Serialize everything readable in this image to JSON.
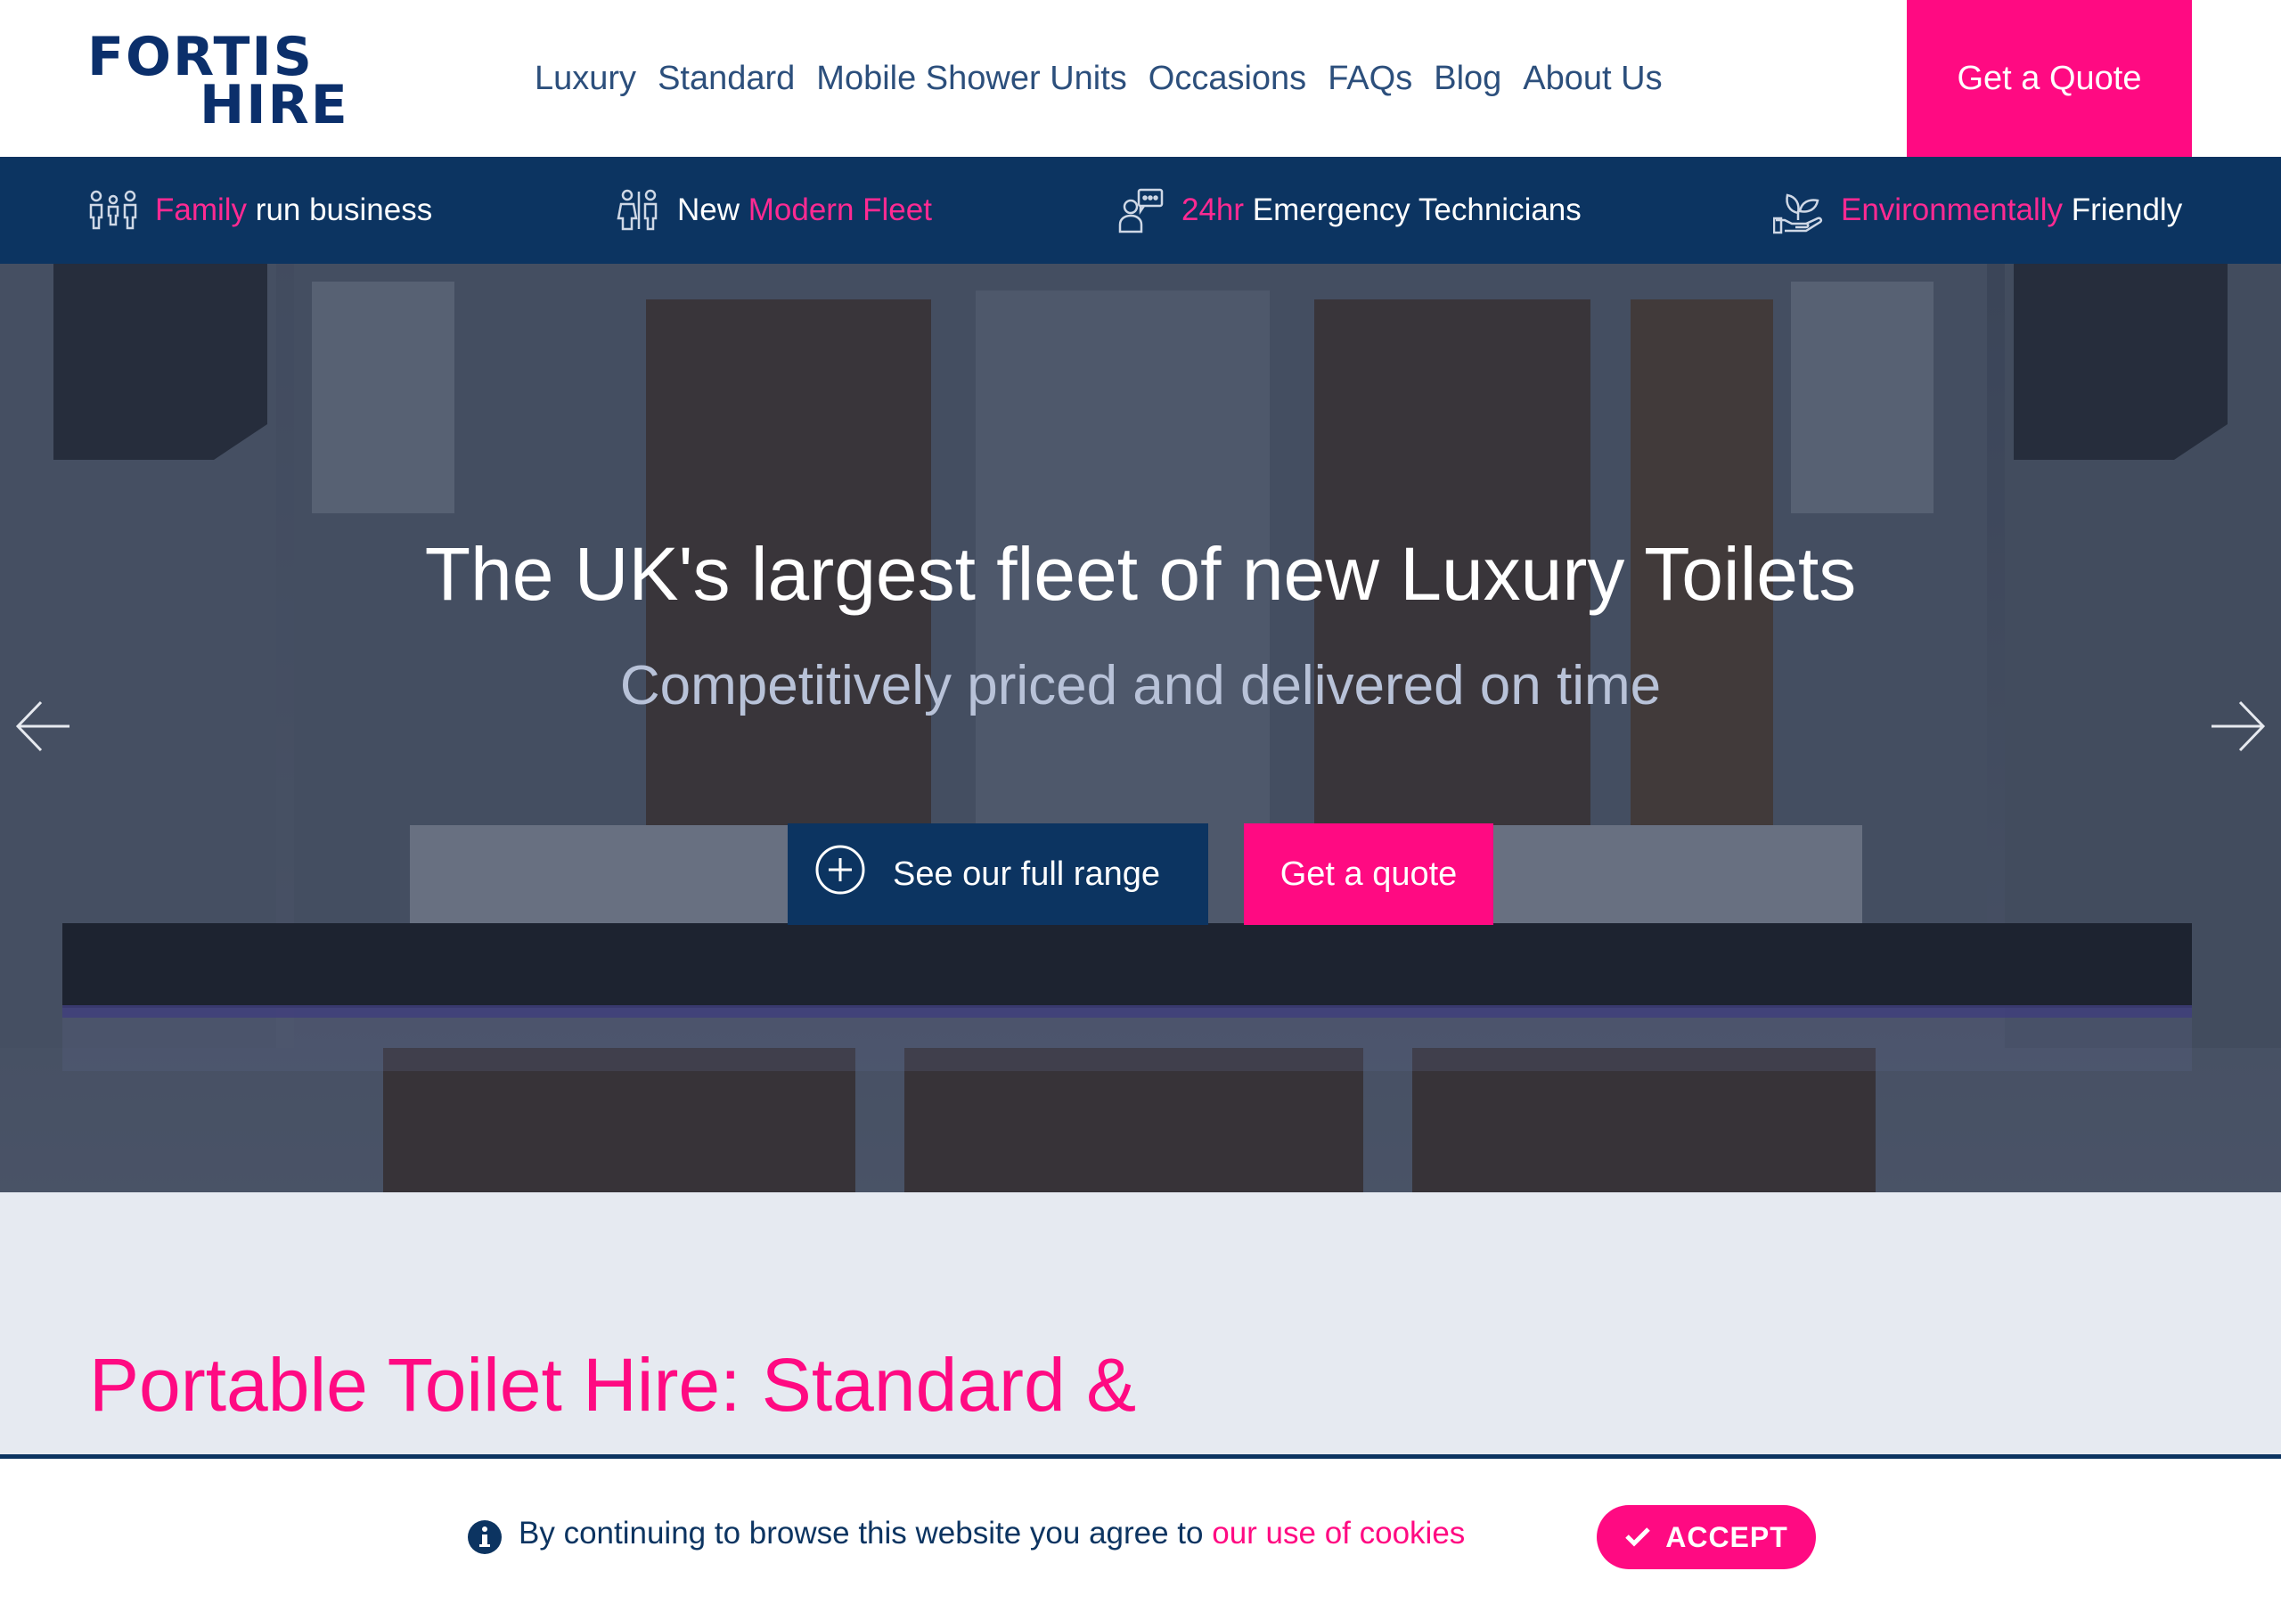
{
  "brand": {
    "logo_line1": "FORTIS",
    "logo_line2": "HIRE",
    "primary_color": "#0c3461",
    "accent_color": "#ff0a82"
  },
  "nav": {
    "items": [
      {
        "label": "Luxury"
      },
      {
        "label": "Standard"
      },
      {
        "label": "Mobile Shower Units"
      },
      {
        "label": "Occasions"
      },
      {
        "label": "FAQs"
      },
      {
        "label": "Blog"
      },
      {
        "label": "About Us"
      }
    ],
    "quote_button": "Get a Quote"
  },
  "features": [
    {
      "icon": "family-icon",
      "highlight": "Family",
      "text": " run business"
    },
    {
      "icon": "restroom-icon",
      "lead": "New ",
      "highlight": "Modern Fleet"
    },
    {
      "icon": "technician-icon",
      "highlight": "24hr",
      "text": " Emergency Technicians"
    },
    {
      "icon": "eco-hand-icon",
      "highlight": "Environmentally",
      "text": " Friendly"
    }
  ],
  "hero": {
    "title": "The UK's largest fleet of new Luxury Toilets",
    "subtitle": "Competitively priced and delivered on time",
    "range_button": "See our full range",
    "quote_button": "Get a quote",
    "prev_icon": "arrow-left-icon",
    "next_icon": "arrow-right-icon"
  },
  "content": {
    "heading": "Portable Toilet Hire: Standard &"
  },
  "cookie": {
    "text": "By continuing to browse this website you agree to ",
    "link": "our use of cookies",
    "accept": "ACCEPT"
  }
}
